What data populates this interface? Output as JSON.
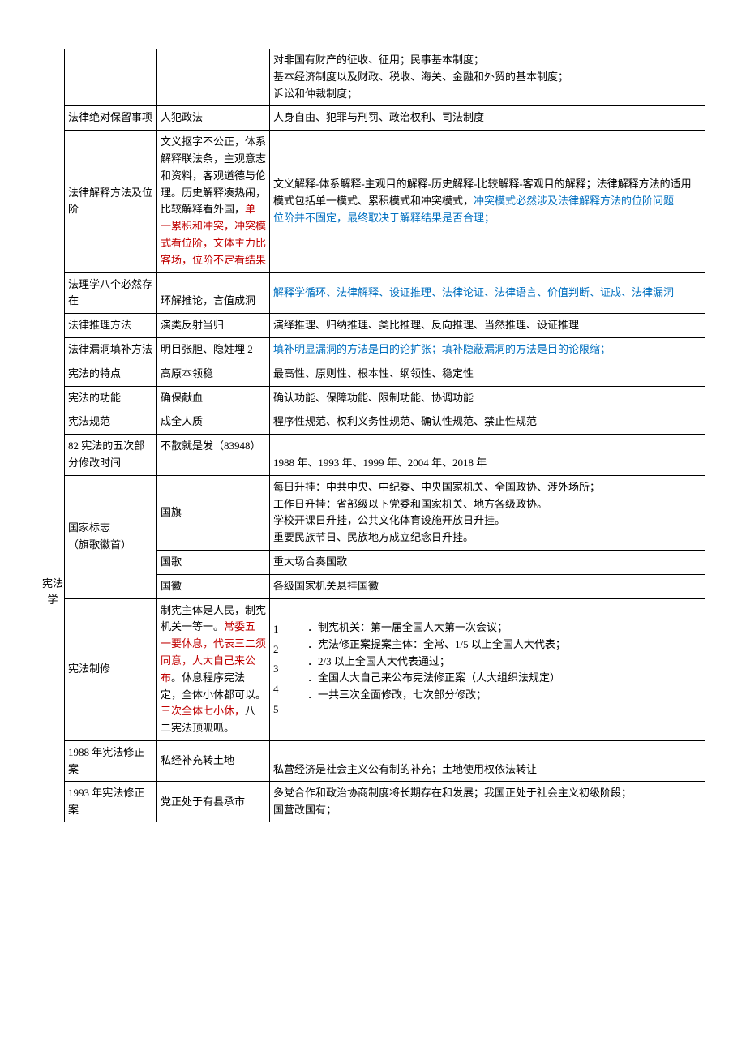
{
  "rows": [
    {
      "c1": "",
      "c2": "",
      "c3": "对非国有财产的征收、征用；民事基本制度；\n基本经济制度以及财政、税收、海关、金融和外贸的基本制度；\n诉讼和仲裁制度；"
    },
    {
      "c1": "法律绝对保留事项",
      "c2": "人犯政法",
      "c3": "人身自由、犯罪与刑罚、政治权利、司法制度"
    },
    {
      "c1": "法律解释方法及位阶",
      "c2_parts": [
        {
          "t": "文义抠字不公正，体系解释联法条，主观意志和资料，客观道德与伦理。历史解释凑热闹，比较解释看外国，",
          "cls": ""
        },
        {
          "t": "单一累积和冲突，冲突模式看位阶，文体主力比客场，位阶不定看结果",
          "cls": "red"
        }
      ],
      "c3_parts": [
        {
          "t": "文义解释-体系解释-主观目的解释-历史解释-比较解释-客观目的解释；法律解释方法的适用模式包括单一模式、累积模式和冲突模式，",
          "cls": ""
        },
        {
          "t": "冲突模式必然涉及法律解释方法的位阶问题",
          "cls": "blue"
        },
        {
          "t": "\n",
          "cls": ""
        },
        {
          "t": "位阶并不固定，最终取决于解释结果是否合理；",
          "cls": "blue"
        }
      ]
    },
    {
      "c1": "法理学八个必然存在",
      "c2": "环解推论，言值成洞",
      "c3_parts": [
        {
          "t": "解释学循环、法律解释、设证推理、法律论证、法律语言、价值判断、证成、法律漏洞",
          "cls": "blue"
        }
      ]
    },
    {
      "c1": "法律推理方法",
      "c2": "演类反射当归",
      "c3": "演绎推理、归纳推理、类比推理、反向推理、当然推理、设证推理"
    },
    {
      "c1": "法律漏洞填补方法",
      "c2": "明目张胆、隐姓埋 2",
      "c3_parts": [
        {
          "t": "填补明显漏洞的方法是目的论扩张；填补隐蔽漏洞的方法是目的论限缩；",
          "cls": "blue"
        }
      ]
    }
  ],
  "category2": "宪法学",
  "rows2": [
    {
      "c1": "宪法的特点",
      "c2": "高原本领稳",
      "c3": "最高性、原则性、根本性、纲领性、稳定性"
    },
    {
      "c1": "宪法的功能",
      "c2": "确保献血",
      "c3": "确认功能、保障功能、限制功能、协调功能"
    },
    {
      "c1": "宪法规范",
      "c2": "成全人质",
      "c3": "程序性规范、权利义务性规范、确认性规范、禁止性规范"
    },
    {
      "c1": "82 宪法的五次部分修改时间",
      "c2": "不散就是发（83948）",
      "c3": "1988 年、1993 年、1999 年、2004 年、2018 年"
    }
  ],
  "flag_group_c1": "国家标志\n（旗歌徽首）",
  "flag_rows": [
    {
      "c2": "国旗",
      "c3": "每日升挂：中共中央、中纪委、中央国家机关、全国政协、涉外场所；\n工作日升挂：省部级以下党委和国家机关、地方各级政协。\n学校开课日升挂，公共文化体育设施开放日升挂。\n重要民族节日、民族地方成立纪念日升挂。"
    },
    {
      "c2": "国歌",
      "c3": "重大场合奏国歌"
    },
    {
      "c2": "国徽",
      "c3": "各级国家机关悬挂国徽"
    }
  ],
  "amend_row": {
    "c1": "宪法制修",
    "c2_parts": [
      {
        "t": "制宪主体是人民，制宪机关一等一。",
        "cls": ""
      },
      {
        "t": "常委五一要休息，代表三二须同意，人大自己来公布",
        "cls": "red"
      },
      {
        "t": "。休息程序宪法定，全体小休都可以。",
        "cls": ""
      },
      {
        "t": "三次全体七小休，",
        "cls": "red"
      },
      {
        "t": "八二宪法顶呱呱。",
        "cls": ""
      }
    ],
    "c3_list": [
      "．制宪机关：第一届全国人大第一次会议；",
      "．宪法修正案提案主体：全常、1/5 以上全国人大代表；",
      "．2/3 以上全国人大代表通过；",
      "．全国人大自己来公布宪法修正案（人大组织法规定）",
      "．一共三次全面修改，七次部分修改；"
    ]
  },
  "rows3": [
    {
      "c1": "1988 年宪法修正案",
      "c2": "私经补充转土地",
      "c3": "私营经济是社会主义公有制的补充；土地使用权依法转让"
    },
    {
      "c1": "1993 年宪法修正案",
      "c2": "党正处于有县承市",
      "c3": "多党合作和政治协商制度将长期存在和发展；我国正处于社会主义初级阶段；\n国营改国有；"
    }
  ]
}
